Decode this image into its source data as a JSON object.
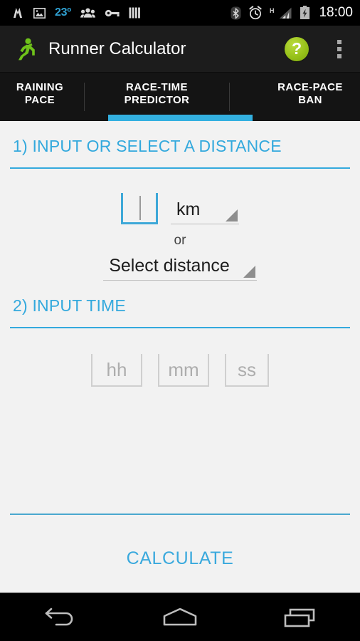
{
  "status_bar": {
    "icons_left": [
      {
        "name": "music-app-icon",
        "glyph": "M"
      },
      {
        "name": "screenshot-image-icon",
        "glyph": "image"
      },
      {
        "name": "weather-temperature",
        "glyph": "23º"
      },
      {
        "name": "people-contacts-icon",
        "glyph": "people"
      },
      {
        "name": "vpn-key-icon",
        "glyph": "key"
      },
      {
        "name": "equalizer-icon",
        "glyph": "bars"
      }
    ],
    "temperature": "23º",
    "bluetooth_label": "bluetooth",
    "alarm_label": "alarm",
    "network_type": "H",
    "signal_label": "signal",
    "battery_label": "battery-charging",
    "clock": "18:00"
  },
  "action_bar": {
    "app_icon_name": "runner-icon",
    "title": "Runner Calculator",
    "help_label": "?",
    "overflow_label": "more-options"
  },
  "tabs": [
    {
      "label": "RAINING PACE",
      "full_label": "TRAINING PACE",
      "active": false,
      "name": "tab-training-pace"
    },
    {
      "label": "RACE-TIME\nPREDICTOR",
      "line1": "RACE-TIME",
      "line2": "PREDICTOR",
      "active": true,
      "name": "tab-race-time-predictor"
    },
    {
      "label": "RACE-PACE BAN",
      "full_label": "RACE-PACE BANDS",
      "active": false,
      "name": "tab-race-pace-bands"
    }
  ],
  "sections": {
    "distance": {
      "heading": "1) INPUT OR SELECT A DISTANCE",
      "distance_value": "",
      "distance_placeholder": "",
      "unit_selected": "km",
      "or_text": "or",
      "select_distance_label": "Select distance"
    },
    "time": {
      "heading": "2) INPUT TIME",
      "hours_value": "",
      "hours_placeholder": "hh",
      "minutes_value": "",
      "minutes_placeholder": "mm",
      "seconds_value": "",
      "seconds_placeholder": "ss"
    }
  },
  "calculate_button": {
    "label": "CALCULATE"
  },
  "nav_bar": {
    "back_label": "back",
    "home_label": "home",
    "recents_label": "recent-apps"
  },
  "colors": {
    "accent_blue": "#33a9dd",
    "tab_indicator": "#33b0e0",
    "brand_green": "#97c21a",
    "status_temp_blue": "#2f9fd0",
    "page_bg": "#f2f2f2",
    "bar_black": "#1c1c1c"
  }
}
